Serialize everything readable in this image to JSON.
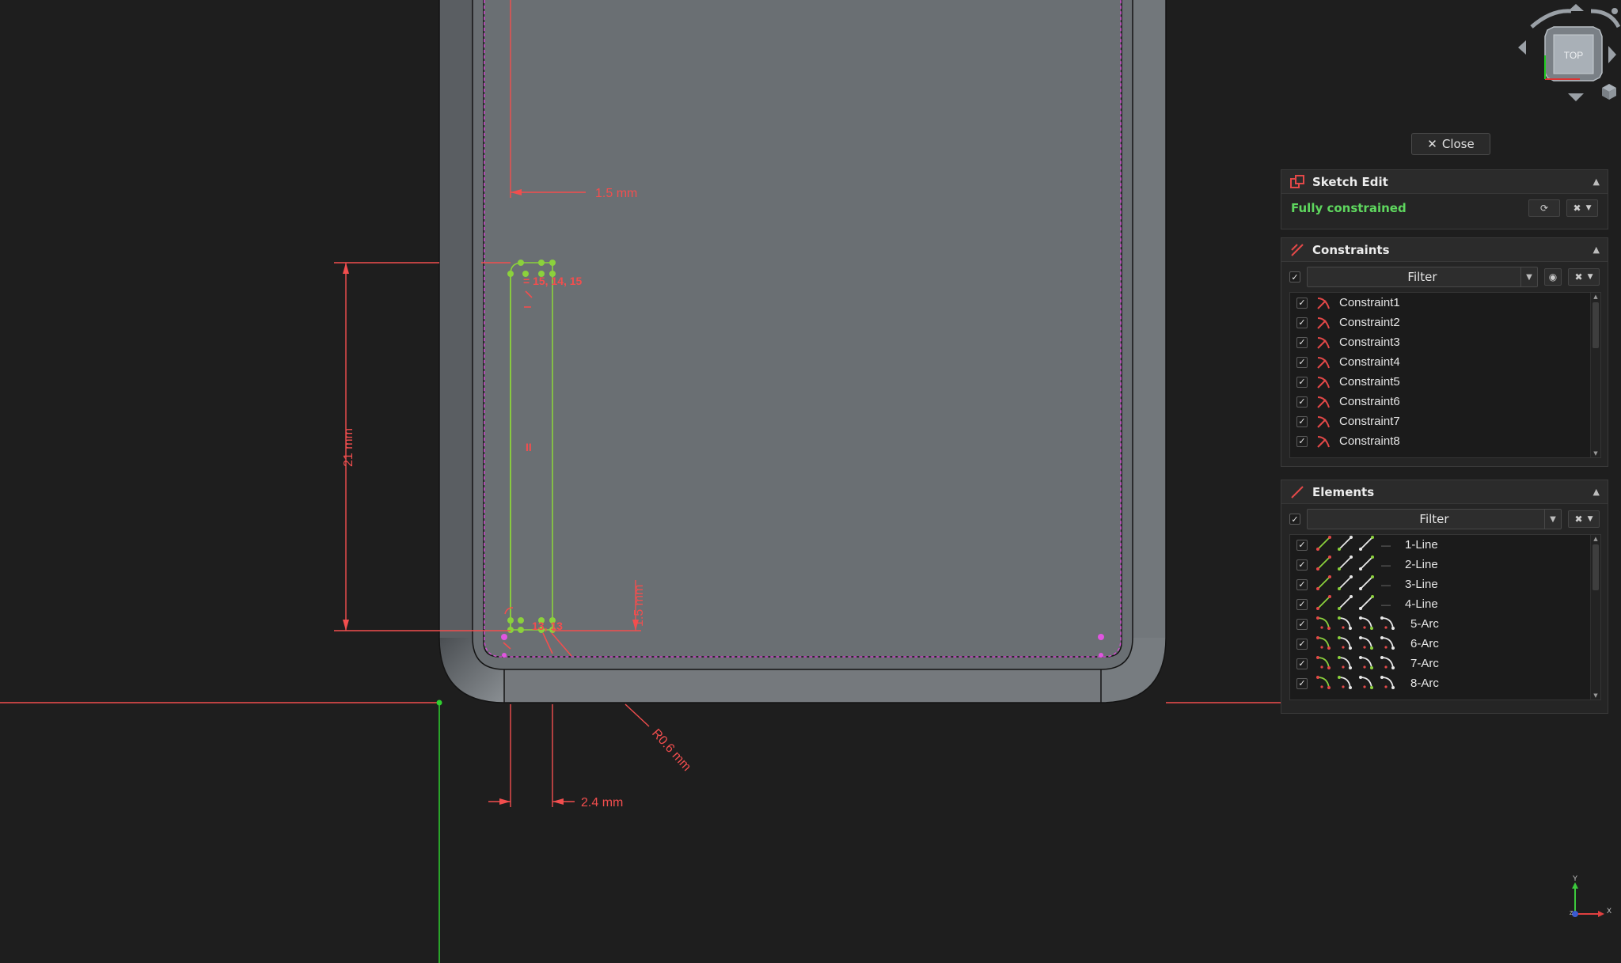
{
  "viewport": {
    "dimensions": {
      "top_horizontal": "1.5 mm",
      "left_vertical": "21 mm",
      "right_vertical": "1.5 mm",
      "bottom_horizontal": "2.4 mm",
      "radius": "R0.6 mm"
    },
    "constraint_labels": {
      "equal_top": "= 15, 14, 15",
      "equal_bottom": "13, 13",
      "parallel": "II"
    },
    "navcube": {
      "face_label": "TOP"
    },
    "axis": {
      "x_label": "X",
      "y_label": "Y",
      "z_label": "Z"
    },
    "colors": {
      "background": "#1e1e1e",
      "solid": "#6a6f73",
      "dimension": "#f24e4e",
      "constraint_geometry": "#8bd13c",
      "external_geometry": "#d04fd0",
      "axis_y": "#2fd02f"
    }
  },
  "close_button": {
    "icon": "close-icon",
    "label": "Close"
  },
  "sketch_edit": {
    "title": "Sketch Edit",
    "icon": "sketch-icon",
    "status": "Fully constrained",
    "status_color": "#5ed65e"
  },
  "constraints": {
    "title": "Constraints",
    "icon": "constraint-icon",
    "filter_label": "Filter",
    "items": [
      {
        "label": "Constraint1"
      },
      {
        "label": "Constraint2"
      },
      {
        "label": "Constraint3"
      },
      {
        "label": "Constraint4"
      },
      {
        "label": "Constraint5"
      },
      {
        "label": "Constraint6"
      },
      {
        "label": "Constraint7"
      },
      {
        "label": "Constraint8"
      }
    ]
  },
  "elements": {
    "title": "Elements",
    "icon": "line-icon",
    "filter_label": "Filter",
    "items": [
      {
        "label": "1-Line",
        "kind": "line"
      },
      {
        "label": "2-Line",
        "kind": "line"
      },
      {
        "label": "3-Line",
        "kind": "line"
      },
      {
        "label": "4-Line",
        "kind": "line"
      },
      {
        "label": "5-Arc",
        "kind": "arc"
      },
      {
        "label": "6-Arc",
        "kind": "arc"
      },
      {
        "label": "7-Arc",
        "kind": "arc"
      },
      {
        "label": "8-Arc",
        "kind": "arc"
      }
    ]
  }
}
